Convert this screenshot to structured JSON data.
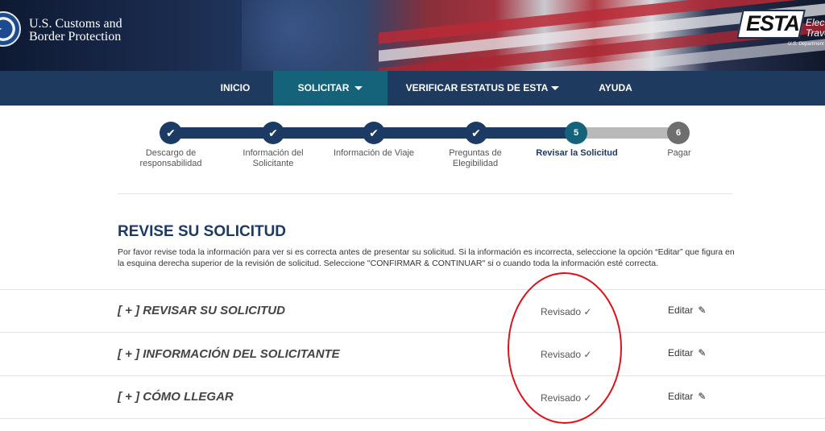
{
  "header": {
    "agency_line1": "U.S. Customs and",
    "agency_line2": "Border Protection",
    "esta_logo_text": "ESTA",
    "esta_side_line1": "Elect",
    "esta_side_line2": "Trave",
    "esta_dept": "U.S. Department"
  },
  "nav": {
    "items": [
      {
        "label": "INICIO"
      },
      {
        "label": "SOLICITAR"
      },
      {
        "label": "VERIFICAR ESTATUS DE ESTA"
      },
      {
        "label": "AYUDA"
      }
    ]
  },
  "progress": {
    "current_step": 5,
    "steps": [
      {
        "number": "1",
        "label": "Descargo de responsabilidad",
        "state": "done"
      },
      {
        "number": "2",
        "label": "Información del Solicitante",
        "state": "done"
      },
      {
        "number": "3",
        "label": "Información de Viaje",
        "state": "done"
      },
      {
        "number": "4",
        "label": "Preguntas de Elegibilidad",
        "state": "done"
      },
      {
        "number": "5",
        "label": "Revisar la Solicitud",
        "state": "current"
      },
      {
        "number": "6",
        "label": "Pagar",
        "state": "future"
      }
    ]
  },
  "main": {
    "title": "REVISE SU SOLICITUD",
    "description": "Por favor revise toda la información para ver si es correcta antes de presentar su solicitud. Si la información es incorrecta, seleccione la opción “Editar” que figura en la esquina derecha superior de la revisión de solicitud. Seleccione \"CONFIRMAR & CONTINUAR\" si o cuando toda la información esté correcta.",
    "sections": [
      {
        "title": "[ + ] REVISAR SU SOLICITUD",
        "status": "Revisado ✓",
        "edit": "Editar"
      },
      {
        "title": "[ + ] INFORMACIÓN DEL SOLICITANTE",
        "status": "Revisado ✓",
        "edit": "Editar"
      },
      {
        "title": "[ + ] CÓMO LLEGAR",
        "status": "Revisado ✓",
        "edit": "Editar"
      }
    ]
  },
  "colors": {
    "nav_bg": "#1f3a5f",
    "nav_active": "#14637a",
    "progress_done": "#1b3a64",
    "progress_todo": "#b9b9b9",
    "annotation": "#e0101a"
  },
  "icons": [
    "dhs-seal-icon",
    "caret-down-icon",
    "check-icon",
    "pencil-icon"
  ]
}
